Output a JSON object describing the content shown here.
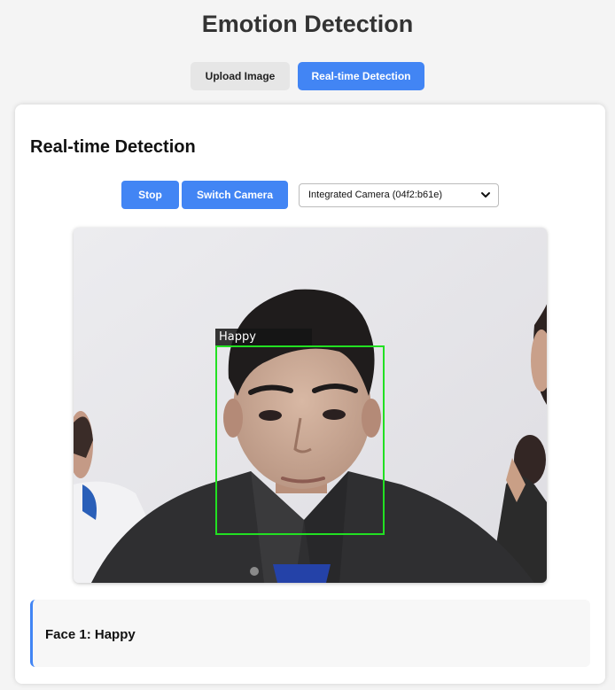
{
  "header": {
    "title": "Emotion Detection"
  },
  "tabs": [
    {
      "label": "Upload Image"
    },
    {
      "label": "Real-time Detection"
    }
  ],
  "panel": {
    "title": "Real-time Detection",
    "stop_label": "Stop",
    "switch_label": "Switch Camera",
    "camera_selected": "Integrated Camera (04f2:b61e)"
  },
  "video": {
    "detections": [
      {
        "label": "Happy",
        "box_color": "#22e022"
      }
    ]
  },
  "results": [
    {
      "text": "Face 1: Happy"
    }
  ],
  "colors": {
    "accent": "#4285f4",
    "background": "#f4f4f4"
  }
}
